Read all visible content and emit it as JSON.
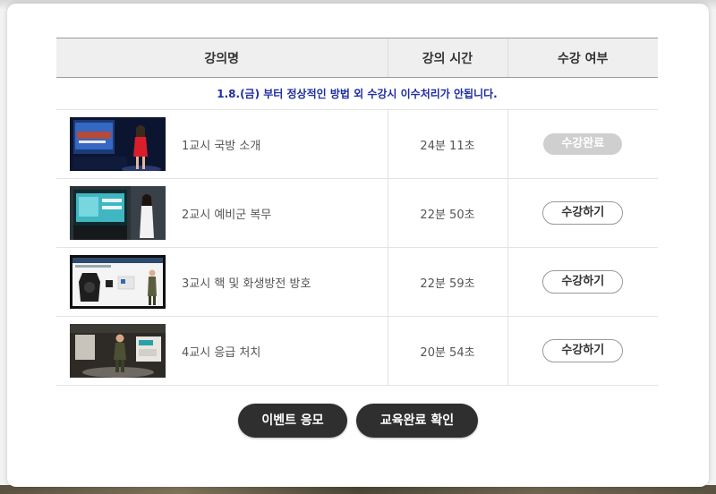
{
  "table": {
    "headers": {
      "title": "강의명",
      "time": "강의 시간",
      "status": "수강 여부"
    },
    "notice": "1.8.(금) 부터 정상적인 방법 외 수강시 이수처리가 안됩니다.",
    "rows": [
      {
        "title": "1교시 국방 소개",
        "duration": "24분 11초",
        "status": "수강완료",
        "completed": true
      },
      {
        "title": "2교시 예비군 복무",
        "duration": "22분 50초",
        "status": "수강하기",
        "completed": false
      },
      {
        "title": "3교시 핵 및 화생방전 방호",
        "duration": "22분 59초",
        "status": "수강하기",
        "completed": false
      },
      {
        "title": "4교시 응급 처치",
        "duration": "20분 54초",
        "status": "수강하기",
        "completed": false
      }
    ]
  },
  "footer": {
    "event_label": "이벤트 응모",
    "complete_label": "교육완료 확인"
  },
  "colors": {
    "notice": "#1f2ea0",
    "button_dark": "#2f2f2f",
    "completed_badge": "#cfcfcf"
  }
}
